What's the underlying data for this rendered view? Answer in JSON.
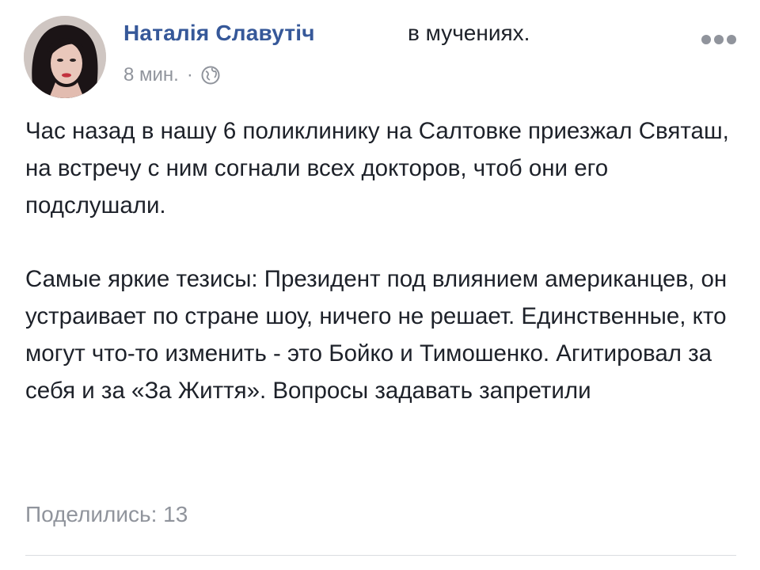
{
  "post": {
    "author_name": "Наталія Славутіч",
    "activity": "в мучениях.",
    "time": "8 мин.",
    "separator": "·",
    "privacy_icon": "globe-icon",
    "more_icon": "more-options-icon",
    "paragraphs": [
      "Час назад в нашу 6 поликлинику на Салтовке приезжал Святаш, на встречу с ним согнали всех докторов, чтоб они его подслушали.",
      "Самые яркие тезисы: Президент под влиянием американцев, он устраивает по стране шоу, ничего не решает. Единственные, кто могут что-то изменить - это Бойко и Тимошенко. Агитировал за себя и за «За Життя». Вопросы задавать запретили"
    ],
    "shares": "Поделились: 13"
  },
  "colors": {
    "author_link": "#365899",
    "text": "#1d2129",
    "meta": "#90949c",
    "divider": "#dadde1"
  }
}
